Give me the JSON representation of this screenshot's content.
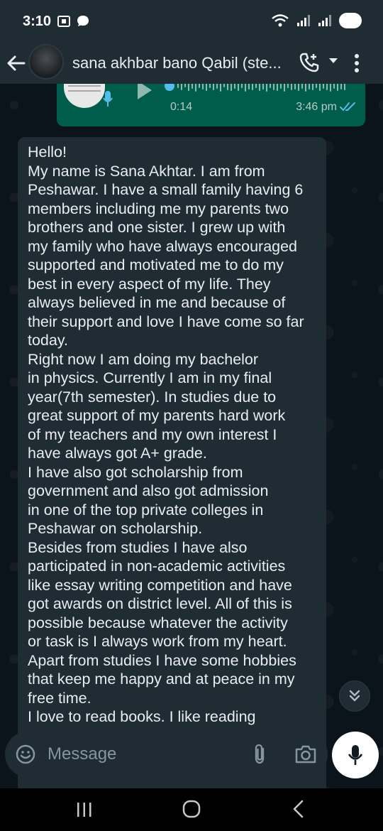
{
  "status_bar": {
    "time": "3:10"
  },
  "header": {
    "contact_name": "sana akhbar bano Qabil (ste..."
  },
  "voice_message": {
    "duration": "0:14",
    "time": "3:46 pm"
  },
  "incoming_message": {
    "lines": [
      "Hello!",
      "My name is Sana Akhtar. I am from",
      "Peshawar. I have a small family having 6",
      "members including me my parents two",
      "brothers and one sister. I grew up with",
      "my family who have always encouraged",
      "supported and motivated me to do my",
      "best in every aspect of my life. They",
      "always believed in me and because of",
      "their support and love I have come so far",
      "today.",
      "Right now  I am doing my bachelor",
      "in physics. Currently I am in my final",
      "year(7th semester). In studies due to",
      "great support of my parents hard work",
      "of my teachers and my own interest I",
      "have always got A+ grade.",
      "I have also got scholarship from",
      "government and also got admission",
      "in one of the top private colleges in",
      "Peshawar on scholarship.",
      "Besides from studies I have also",
      "participated in non-academic activities",
      "like essay writing competition and have",
      "got awards on district level. All of this is",
      "possible because whatever the activity",
      "or task is I always work from my heart.",
      "Apart from studies I have some hobbies",
      "that keep me happy and at peace in my",
      "free time.",
      "I love to read books. I like reading"
    ]
  },
  "input": {
    "placeholder": "Message"
  },
  "colors": {
    "background": "#0b141a",
    "header": "#1f2c34",
    "incoming_bubble": "#1f2c34",
    "outgoing_bubble": "#005c4b",
    "read_tick": "#53bdeb"
  },
  "icons": {
    "back": "arrow-left-icon",
    "call": "phone-icon",
    "dropdown": "chevron-down-icon",
    "menu": "more-vertical-icon",
    "emoji": "emoji-icon",
    "attach": "paperclip-icon",
    "camera": "camera-icon",
    "mic": "microphone-icon",
    "scroll": "double-chevron-down-icon"
  }
}
